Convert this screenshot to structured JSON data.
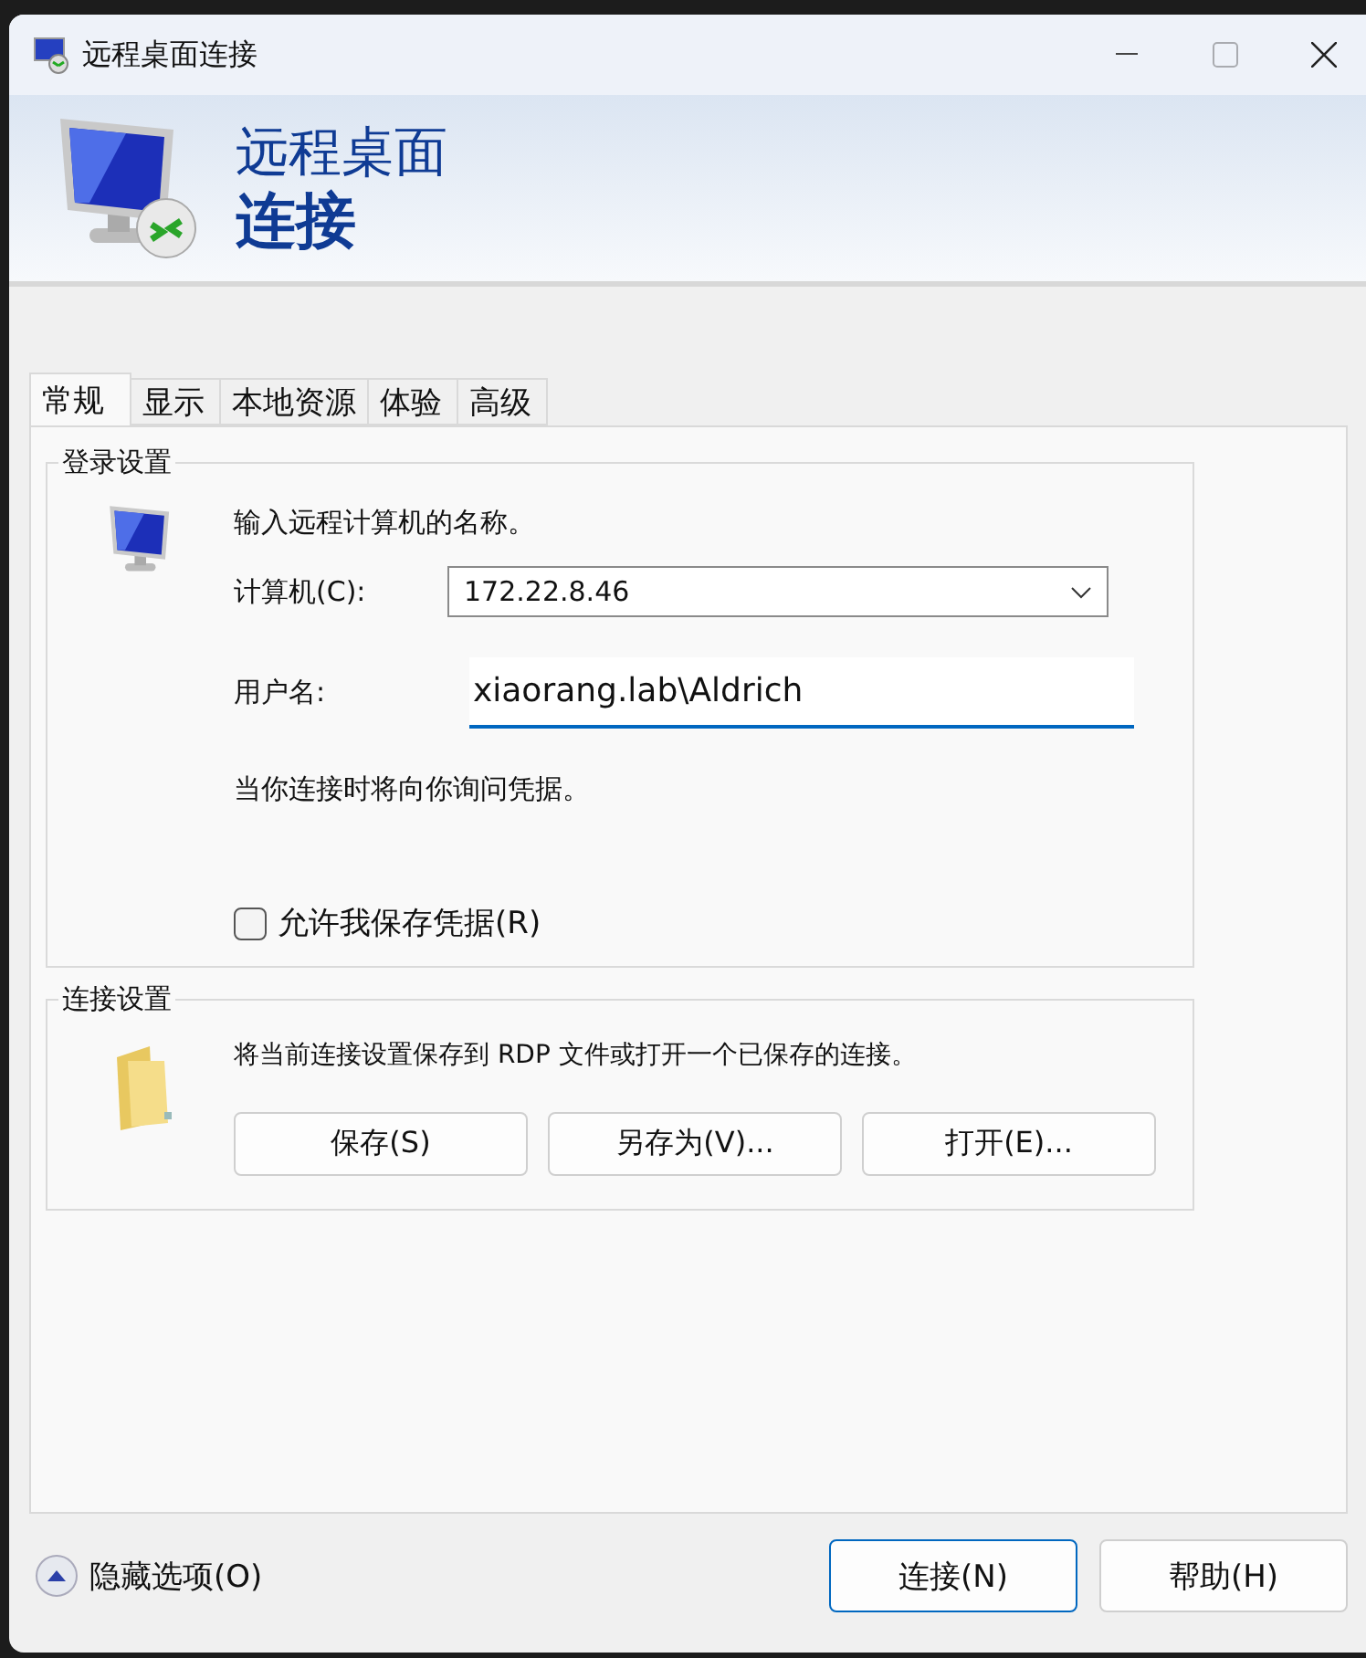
{
  "window": {
    "title": "远程桌面连接"
  },
  "banner": {
    "line_1": "远程桌面",
    "line_2": "连接"
  },
  "tabs": [
    {
      "label": "常规",
      "selected": true
    },
    {
      "label": "显示",
      "selected": false
    },
    {
      "label": "本地资源",
      "selected": false
    },
    {
      "label": "体验",
      "selected": false
    },
    {
      "label": "高级",
      "selected": false
    }
  ],
  "login_group": {
    "legend": "登录设置",
    "prompt": "输入远程计算机的名称。",
    "computer": {
      "label": "计算机(C):",
      "value": "172.22.8.46"
    },
    "username": {
      "label": "用户名:",
      "value": "xiaorang.lab\\Aldrich",
      "focused": true
    },
    "note": "当你连接时将向你询问凭据。",
    "save_credentials": {
      "label": "允许我保存凭据(R)",
      "checked": false
    }
  },
  "connection_group": {
    "legend": "连接设置",
    "description": "将当前连接设置保存到 RDP 文件或打开一个已保存的连接。",
    "buttons": [
      "保存(S)",
      "另存为(V)...",
      "打开(E)..."
    ]
  },
  "options_toggle": {
    "label": "隐藏选项(O)",
    "expanded": true
  },
  "buttons": [
    {
      "label": "连接(N)",
      "default": true
    },
    {
      "label": "帮助(H)",
      "default": false
    }
  ]
}
